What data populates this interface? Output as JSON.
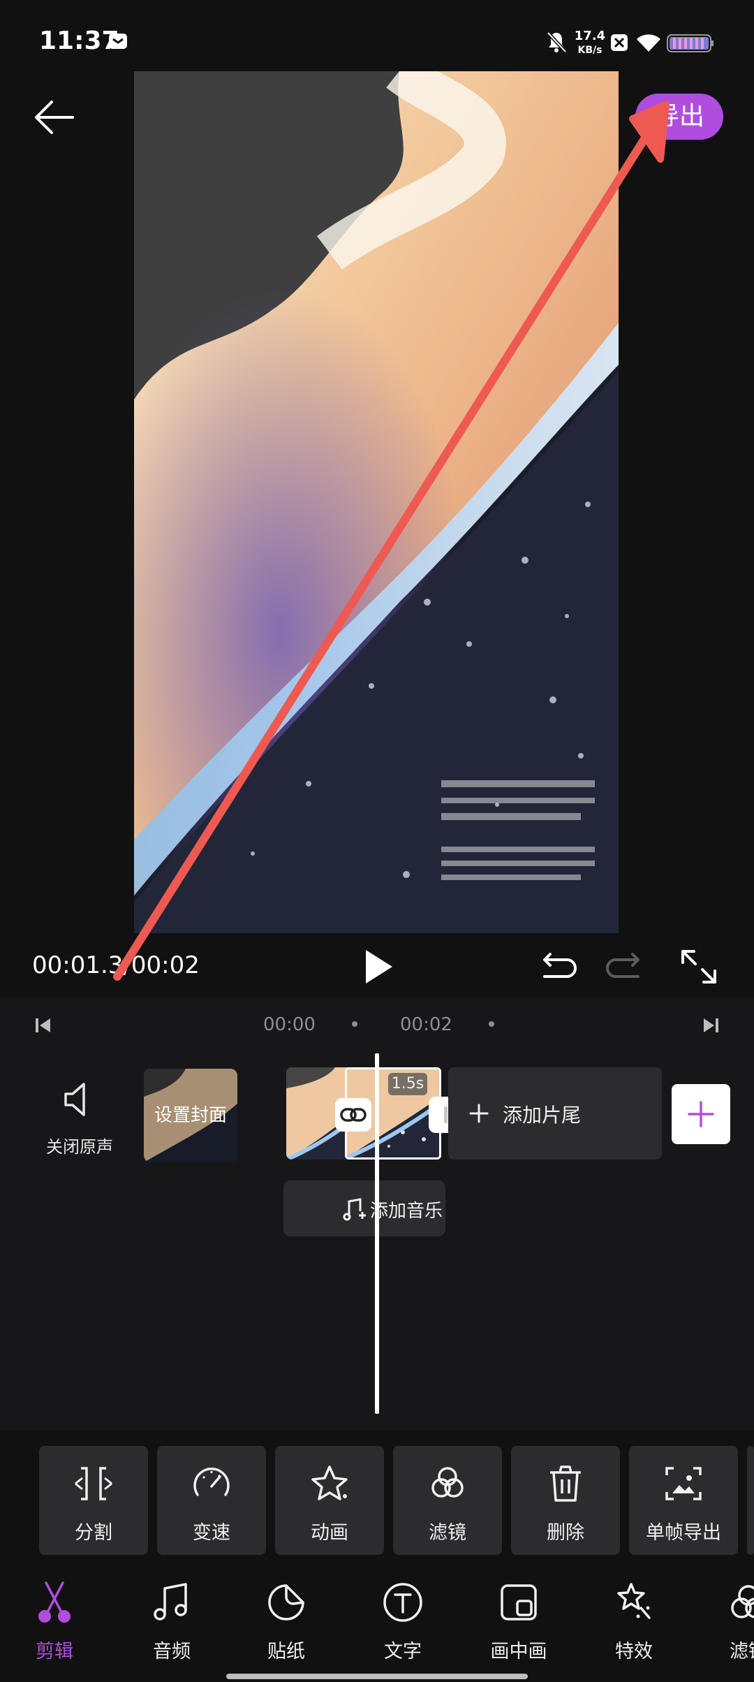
{
  "status_bar": {
    "time": "11:37",
    "net_speed_value": "17.4",
    "net_speed_unit": "KB/s",
    "icons": [
      "mail-icon",
      "mute-bell-icon",
      "x-box-icon",
      "wifi-icon",
      "battery-icon"
    ]
  },
  "header": {
    "back_icon": "back-arrow-icon",
    "export_label": "导出"
  },
  "player": {
    "timecode": "00:01.3/00:02",
    "icons": [
      "play-icon",
      "undo-icon",
      "redo-icon",
      "fullscreen-icon"
    ]
  },
  "timeline": {
    "ticks": [
      "00:00",
      "00:02"
    ],
    "mute_label": "关闭原声",
    "cover_label": "设置封面",
    "clip_duration": "1.5s",
    "add_tail_label": "添加片尾",
    "add_music_label": "添加音乐"
  },
  "tools": [
    {
      "label": "分割",
      "icon": "split-icon"
    },
    {
      "label": "变速",
      "icon": "speed-icon"
    },
    {
      "label": "动画",
      "icon": "star-animation-icon"
    },
    {
      "label": "滤镜",
      "icon": "filter-icon"
    },
    {
      "label": "删除",
      "icon": "trash-icon"
    },
    {
      "label": "单帧导出",
      "icon": "frame-export-icon"
    }
  ],
  "bottom_nav": [
    {
      "label": "剪辑",
      "icon": "scissors-icon",
      "active": true
    },
    {
      "label": "音频",
      "icon": "music-note-icon"
    },
    {
      "label": "贴纸",
      "icon": "sticker-icon"
    },
    {
      "label": "文字",
      "icon": "text-icon"
    },
    {
      "label": "画中画",
      "icon": "picture-in-picture-icon"
    },
    {
      "label": "特效",
      "icon": "effects-icon"
    },
    {
      "label": "滤镜",
      "icon": "filter-icon"
    }
  ],
  "colors": {
    "accent": "#b04ddf",
    "background": "#111112",
    "panel": "#2c2c2e",
    "annotation_arrow": "#ee5a52"
  }
}
